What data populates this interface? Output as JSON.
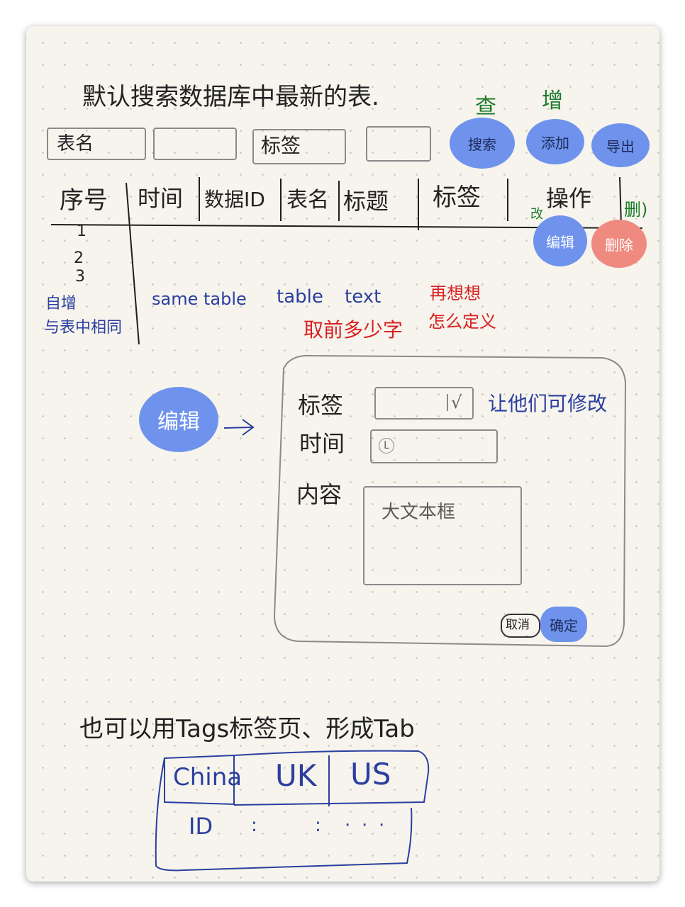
{
  "heading": "默认搜索数据库中最新的表.",
  "search_bar": {
    "table_label": "表名",
    "tag_label": "标签"
  },
  "buttons": {
    "search": "搜索",
    "add": "添加",
    "export": "导出",
    "edit": "编辑",
    "delete": "删除",
    "cancel": "取消",
    "confirm": "确定"
  },
  "annotations": {
    "search_note": "查",
    "add_note": "增",
    "edit_note": "改",
    "delete_note": "删)",
    "auto_inc_1": "自增",
    "auto_inc_2": "与表中相同",
    "same_table": "same table",
    "table": "table",
    "text": "text",
    "pre_chars": "取前多少字",
    "think_1": "再想想",
    "think_2": "怎么定义",
    "editable": "让他们可修改"
  },
  "table": {
    "columns": [
      "序号",
      "时间",
      "数据ID",
      "表名",
      "标题",
      "标签",
      "操作"
    ],
    "rows": [
      "1",
      "2",
      "3"
    ]
  },
  "edit_dialog": {
    "trigger": "编辑",
    "arrow": "→",
    "tag_label": "标签",
    "tag_check": "√",
    "time_label": "时间",
    "time_icon": "L",
    "content_label": "内容",
    "content_placeholder": "大文本框"
  },
  "tabs_section": {
    "note": "也可以用Tags标签页、形成Tab",
    "tabs": [
      "China",
      "UK",
      "US"
    ],
    "content": [
      "ID",
      ":",
      ":",
      "·",
      "·",
      "·"
    ]
  }
}
